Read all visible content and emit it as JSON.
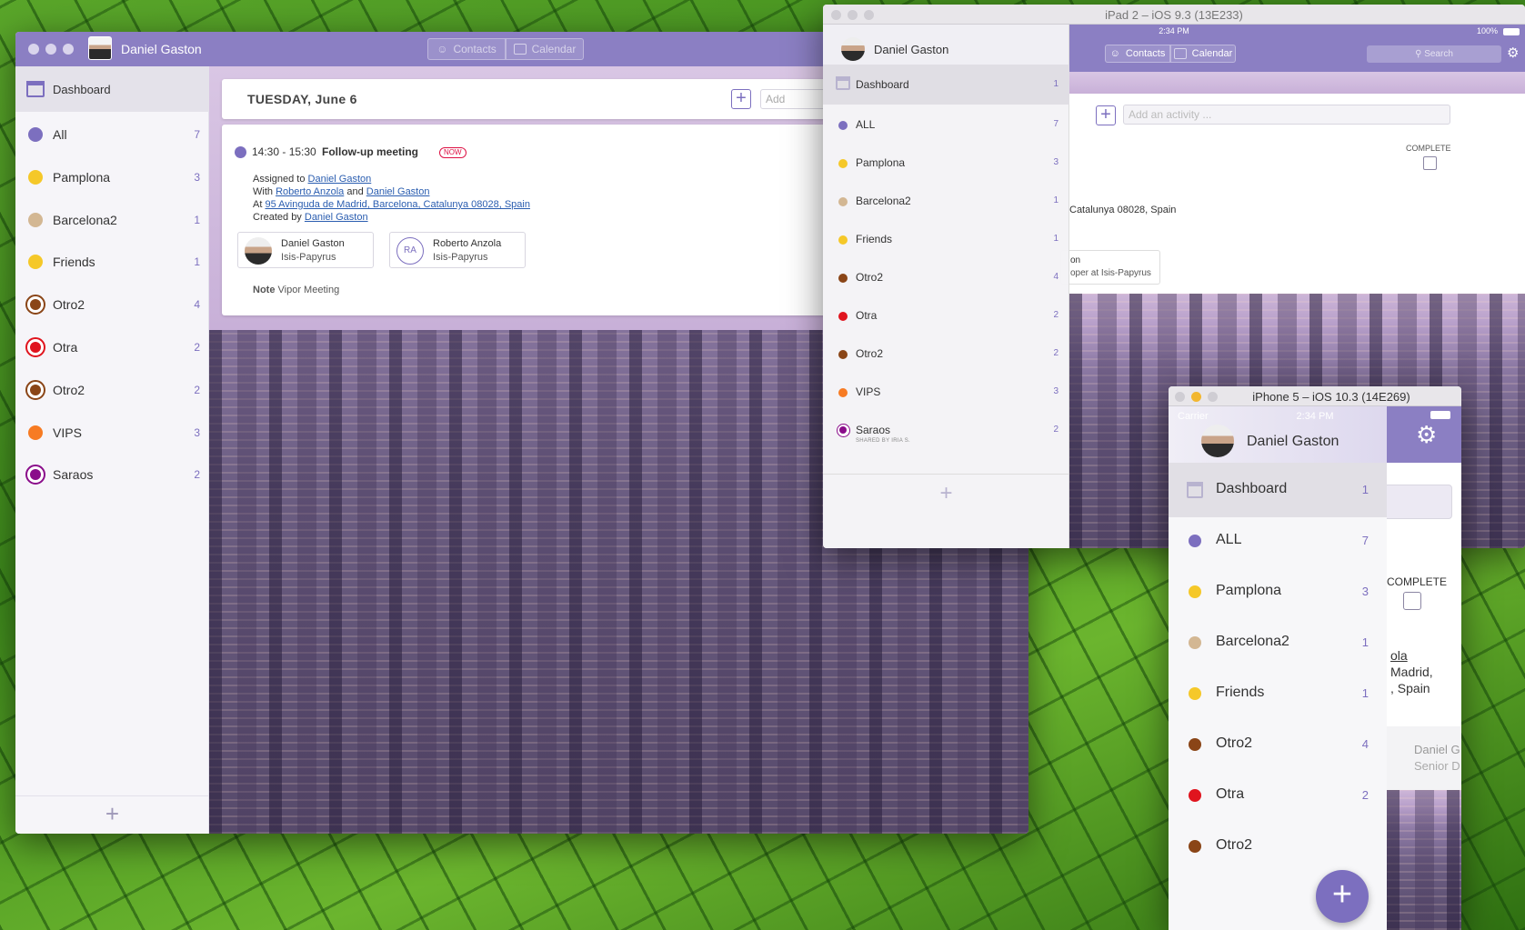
{
  "mac": {
    "user_name": "Daniel Gaston",
    "tabs": {
      "contacts": "Contacts",
      "calendar": "Calendar"
    },
    "sidebar": {
      "dashboard": "Dashboard",
      "items": [
        {
          "label": "All",
          "count": "7",
          "color": "#7c6fbf",
          "ring": false
        },
        {
          "label": "Pamplona",
          "count": "3",
          "color": "#f5c829",
          "ring": false
        },
        {
          "label": "Barcelona2",
          "count": "1",
          "color": "#d3b793",
          "ring": false
        },
        {
          "label": "Friends",
          "count": "1",
          "color": "#f5c829",
          "ring": false
        },
        {
          "label": "Otro2",
          "count": "4",
          "color": "#8a4517",
          "ring": true
        },
        {
          "label": "Otra",
          "count": "2",
          "color": "#e0141e",
          "ring": true
        },
        {
          "label": "Otro2",
          "count": "2",
          "color": "#8a4517",
          "ring": true
        },
        {
          "label": "VIPS",
          "count": "3",
          "color": "#f77b23",
          "ring": false
        },
        {
          "label": "Saraos",
          "count": "2",
          "color": "#8a0c8a",
          "ring": true
        }
      ],
      "add_icon": "plus-icon"
    },
    "day_header": {
      "title": "TUESDAY, June 6",
      "add_placeholder": "Add"
    },
    "event": {
      "time": "14:30 - 15:30",
      "title": "Follow-up meeting",
      "badge": "NOW",
      "assigned_prefix": "Assigned to",
      "assigned_to": "Daniel Gaston",
      "with_prefix": "With",
      "with_1": "Roberto Anzola",
      "and_word": "and",
      "with_2": "Daniel Gaston",
      "at_prefix": "At",
      "location": "95 Avinguda de Madrid, Barcelona, Catalunya 08028, Spain",
      "created_prefix": "Created by",
      "created_by": "Daniel Gaston",
      "people": [
        {
          "name": "Daniel Gaston",
          "company": "Isis-Papyrus",
          "initials": ""
        },
        {
          "name": "Roberto Anzola",
          "company": "Isis-Papyrus",
          "initials": "RA"
        }
      ],
      "note_label": "Note",
      "note_text": "Vipor Meeting"
    }
  },
  "ipad": {
    "window_title": "iPad 2 – iOS 9.3 (13E233)",
    "status_time": "2:34 PM",
    "status_battery": "100%",
    "tabs": {
      "contacts": "Contacts",
      "calendar": "Calendar"
    },
    "search_placeholder": "Search",
    "user_name": "Daniel Gaston",
    "add_activity_placeholder": "Add an activity ...",
    "complete_label": "COMPLETE",
    "location_fragment": "Catalunya 08028, Spain",
    "person_fragment_name": "on",
    "person_fragment_role": "oper at Isis-Papyrus",
    "sidebar": {
      "dashboard": "Dashboard",
      "dashboard_count": "1",
      "items": [
        {
          "label": "ALL",
          "count": "7",
          "color": "#7c6fbf",
          "ring": false,
          "sub": ""
        },
        {
          "label": "Pamplona",
          "count": "3",
          "color": "#f5c829",
          "ring": false,
          "sub": ""
        },
        {
          "label": "Barcelona2",
          "count": "1",
          "color": "#d3b793",
          "ring": false,
          "sub": ""
        },
        {
          "label": "Friends",
          "count": "1",
          "color": "#f5c829",
          "ring": false,
          "sub": ""
        },
        {
          "label": "Otro2",
          "count": "4",
          "color": "#8a4517",
          "ring": false,
          "sub": ""
        },
        {
          "label": "Otra",
          "count": "2",
          "color": "#e0141e",
          "ring": false,
          "sub": ""
        },
        {
          "label": "Otro2",
          "count": "2",
          "color": "#8a4517",
          "ring": false,
          "sub": ""
        },
        {
          "label": "VIPS",
          "count": "3",
          "color": "#f77b23",
          "ring": false,
          "sub": ""
        },
        {
          "label": "Saraos",
          "count": "2",
          "color": "#8a0c8a",
          "ring": true,
          "sub": "SHARED BY IRIA S."
        }
      ]
    }
  },
  "iphone": {
    "window_title": "iPhone 5 – iOS 10.3 (14E269)",
    "carrier": "Carrier",
    "status_time": "2:34 PM",
    "user_name": "Daniel Gaston",
    "complete_label": "COMPLETE",
    "fragments": {
      "line1": "ola",
      "line2": "Madrid,",
      "line3": ", Spain",
      "person_name": "Daniel G",
      "person_role": "Senior D"
    },
    "sidebar": {
      "dashboard": "Dashboard",
      "dashboard_count": "1",
      "items": [
        {
          "label": "ALL",
          "count": "7",
          "color": "#7c6fbf"
        },
        {
          "label": "Pamplona",
          "count": "3",
          "color": "#f5c829"
        },
        {
          "label": "Barcelona2",
          "count": "1",
          "color": "#d3b793"
        },
        {
          "label": "Friends",
          "count": "1",
          "color": "#f5c829"
        },
        {
          "label": "Otro2",
          "count": "4",
          "color": "#8a4517"
        },
        {
          "label": "Otra",
          "count": "2",
          "color": "#e0141e"
        },
        {
          "label": "Otro2",
          "count": "",
          "color": "#8a4517"
        }
      ]
    }
  }
}
